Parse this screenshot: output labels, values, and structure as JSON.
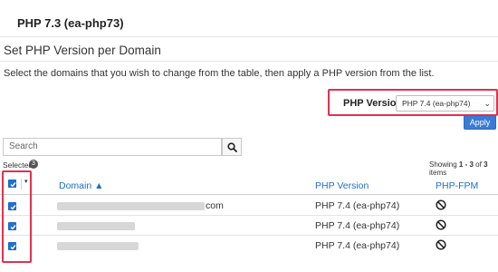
{
  "header": {
    "top_snippet": "⁻",
    "section_title": "PHP 7.3 (ea-php73)"
  },
  "page": {
    "heading": "Set PHP Version per Domain",
    "description": "Select the domains that you wish to change from the table, then apply a PHP version from the list."
  },
  "php_selector": {
    "label": "PHP Version",
    "selected": "PHP 7.4 (ea-php74)",
    "apply_label": "Apply"
  },
  "search": {
    "placeholder": "Search"
  },
  "selection": {
    "label": "Selected",
    "count": "3"
  },
  "pagination": {
    "prefix": "Showing ",
    "range": "1 - 3",
    "middle": " of ",
    "total": "3",
    "suffix": " items"
  },
  "table": {
    "columns": {
      "domain": "Domain ▲",
      "php_version": "PHP Version",
      "php_fpm": "PHP-FPM"
    },
    "rows": [
      {
        "domain_suffix": "com",
        "php_version": "PHP 7.4 (ea-php74)",
        "checked": true
      },
      {
        "domain_suffix": "",
        "php_version": "PHP 7.4 (ea-php74)",
        "checked": true
      },
      {
        "domain_suffix": "",
        "php_version": "PHP 7.4 (ea-php74)",
        "checked": true
      }
    ]
  },
  "colors": {
    "highlight": "#e0314f",
    "accent": "#1f6fc4",
    "button": "#3a7bd5"
  }
}
